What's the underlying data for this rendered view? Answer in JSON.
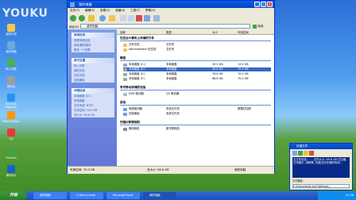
{
  "watermark": "YOUKU",
  "desktop_icons": [
    {
      "label": "我的文档",
      "color": "#f2c94c"
    },
    {
      "label": "我的电脑",
      "color": "#6fa8dc"
    },
    {
      "label": "网上邻居",
      "color": "#4caf50"
    },
    {
      "label": "回收站",
      "color": "#9e9e9e"
    },
    {
      "label": "Internet Explorer",
      "color": "#2196f3"
    },
    {
      "label": "Media Player",
      "color": "#ff9800"
    },
    {
      "label": "QQ",
      "color": "#e53935"
    },
    {
      "label": "Foxmail",
      "color": "#43a047"
    },
    {
      "label": "腾讯QQ",
      "color": "#1565c0"
    }
  ],
  "explorer": {
    "title": "我的电脑",
    "menu": [
      "文件(F)",
      "编辑(E)",
      "查看(V)",
      "收藏(A)",
      "工具(T)",
      "帮助(H)"
    ],
    "address_label": "地址(D)",
    "address_value": "我的电脑",
    "go_label": "转到",
    "columns": [
      "名称",
      "类型",
      "大小",
      "可用空间"
    ],
    "groups": [
      {
        "title": "在这台计算机上存储的文件",
        "rows": [
          {
            "name": "共享文档",
            "type": "文件夹"
          },
          {
            "name": "Administrator 的文档",
            "type": "文件夹"
          }
        ]
      },
      {
        "title": "硬盘",
        "rows": [
          {
            "name": "本地磁盘 (C:)",
            "type": "本地磁盘",
            "size": "19.5 GB",
            "free": "13.5 GB"
          },
          {
            "name": "本地磁盘 (D:)",
            "type": "本地磁盘",
            "size": "58.6 GB",
            "free": "70.0 GB",
            "selected": true
          },
          {
            "name": "本地磁盘 (E:)",
            "type": "本地磁盘",
            "size": "78.6 GB",
            "free": "70.0 GB"
          },
          {
            "name": "本地磁盘 (F:)",
            "type": "本地磁盘",
            "size": "68.8 GB",
            "free": "70.0 GB"
          }
        ]
      },
      {
        "title": "有可移动存储的设备",
        "rows": [
          {
            "name": "DVD 驱动器",
            "type": "CD 驱动器"
          }
        ]
      },
      {
        "title": "其他",
        "rows": [
          {
            "name": "网络驱动器",
            "type": "系统文件夹",
            "size": "",
            "free": "数据并控制"
          },
          {
            "name": "控制面板",
            "type": "系统文件夹"
          }
        ]
      },
      {
        "title": "扫描仪和照相机",
        "rows": [
          {
            "name": "数码相机",
            "type": "数字照相机"
          }
        ]
      }
    ],
    "tasks_panels": [
      {
        "title": "系统任务",
        "items": [
          "查看系统信息",
          "添加/删除程序",
          "更改一个设置"
        ]
      },
      {
        "title": "其它位置",
        "items": [
          "网上邻居",
          "我的文档",
          "共享文档",
          "控制面板"
        ]
      },
      {
        "title": "详细信息",
        "items": [
          "本地磁盘 (D:)",
          "本地磁盘",
          "文件系统: NTFS",
          "可用空间: 70.0 GB",
          "总大小: 58.6 GB"
        ]
      }
    ],
    "status_left": "可用空间: 70.0 GB",
    "status_mid": "总大小: 58.6 GB",
    "status_right": "我的电脑"
  },
  "dialog": {
    "title": "压缩文件",
    "body": "当文件信息... ... 文件大小: 58.6 GB 已压缩, 已传输中, 请稍等, 压缩文件存储的时间...",
    "bar1": "文件路径:",
    "bar2": "C:\\Documents and Settings\\..."
  },
  "taskbar": {
    "start": "开始",
    "tasks": [
      "我的电脑",
      "C:\\Documents",
      "Microsoft Excel",
      "我的电脑"
    ],
    "clock": "10:38"
  }
}
